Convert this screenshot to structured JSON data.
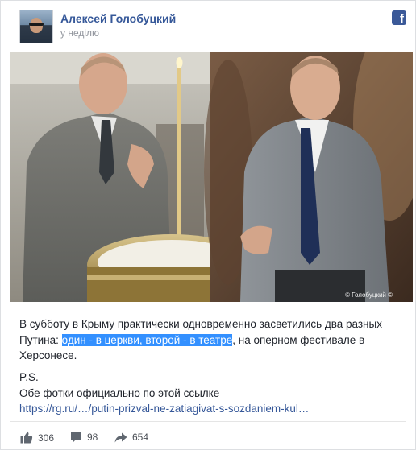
{
  "post": {
    "author": "Алексей Голобуцкий",
    "timestamp": "у неділю",
    "text_before": "В субботу в Крыму практически одновременно засветились два разных Путина: ",
    "text_highlight": "один - в церкви, второй - в театре",
    "text_after": ", на оперном фестивале в Херсонесе.",
    "ps": "P.S.",
    "link_intro": "Обе фотки официально по этой ссылке",
    "link_text": "https://rg.ru/…/putin-prizval-ne-zatiagivat-s-sozdaniem-kul…",
    "photo_watermark": "© Голобуцкий ©"
  },
  "stats": {
    "likes": "306",
    "comments": "98",
    "shares": "654"
  },
  "icons": {
    "platform": "facebook-icon",
    "like": "thumbs-up-icon",
    "comment": "comment-bubble-icon",
    "share": "share-arrow-icon"
  },
  "colors": {
    "name_link": "#365899",
    "facebook_blue": "#3b5998",
    "selection_highlight": "#3390ff",
    "meta_gray": "#90949c"
  }
}
